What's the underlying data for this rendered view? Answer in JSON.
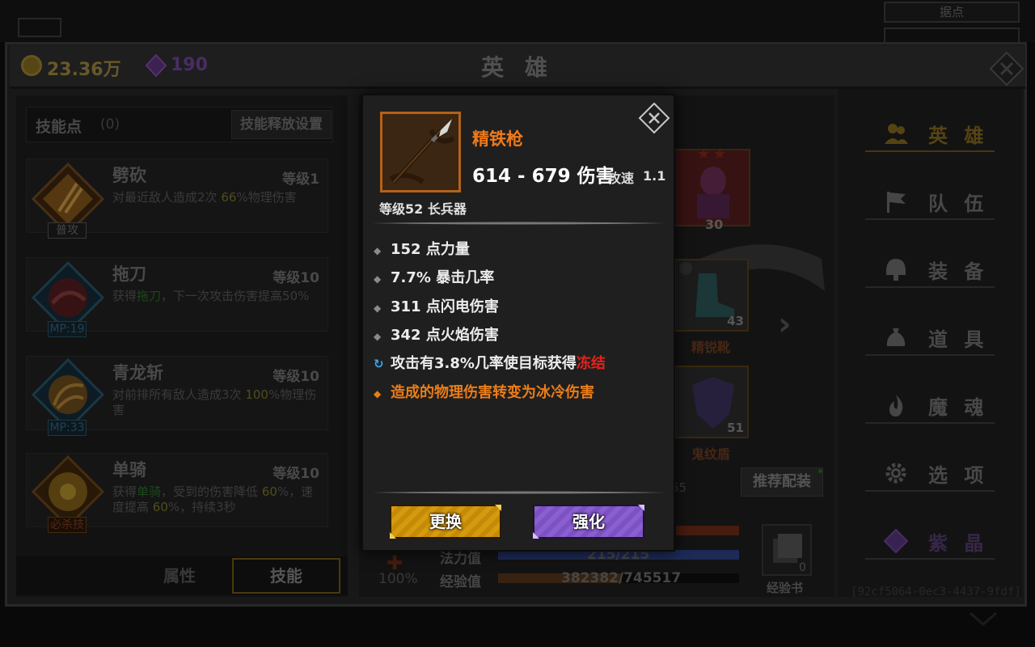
{
  "top": {
    "tag_label": "据点"
  },
  "header": {
    "gold": "23.36万",
    "gems": "190",
    "title": "英 雄"
  },
  "skills_panel": {
    "points_label": "技能点",
    "points_value": "(0)",
    "release_settings": "技能释放设置",
    "items": [
      {
        "name": "劈砍",
        "level": "等级1",
        "tag": "普攻",
        "desc_parts": [
          "对最近敌人造成2次 ",
          "66",
          "%物理伤害"
        ]
      },
      {
        "name": "拖刀",
        "level": "等级10",
        "tag": "MP:19",
        "desc_parts": [
          "获得",
          "拖刀",
          "，下一次攻击伤害提高50%"
        ]
      },
      {
        "name": "青龙斩",
        "level": "等级10",
        "tag": "MP:33",
        "desc_parts": [
          "对前排所有敌人造成3次 ",
          "100",
          "%物理伤害"
        ]
      },
      {
        "name": "单骑",
        "level": "等级10",
        "tag": "必杀技",
        "desc_parts": [
          "获得",
          "单骑",
          "，受到的伤害降低 ",
          "60",
          "%，速度提高 ",
          "60",
          "%，持续3秒"
        ]
      }
    ],
    "tabs": {
      "attributes": "属性",
      "skills": "技能"
    }
  },
  "hero_area": {
    "hero_level": "30",
    "boots": {
      "level": "43",
      "name": "精锐靴"
    },
    "shield": {
      "level": "51",
      "name": "鬼纹盾"
    },
    "recommend_button": "推荐配装",
    "partial_number": "55",
    "pct": "100%",
    "stats": [
      {
        "label": "法力值",
        "value": "215/215",
        "fill": 1.0
      },
      {
        "label": "经验值",
        "value": "382382/745517",
        "fill": 0.513
      }
    ],
    "exp_book": {
      "count": "0",
      "label": "经验书"
    }
  },
  "nav": {
    "items": [
      {
        "label": "英 雄",
        "icon": "people-icon"
      },
      {
        "label": "队 伍",
        "icon": "flag-icon"
      },
      {
        "label": "装 备",
        "icon": "helmet-icon"
      },
      {
        "label": "道 具",
        "icon": "bag-icon"
      },
      {
        "label": "魔 魂",
        "icon": "flame-icon"
      },
      {
        "label": "选 项",
        "icon": "gear-icon"
      },
      {
        "label": "紫 晶",
        "icon": "gem-icon"
      }
    ],
    "guid": "[92cf5064-0ec3-4437-9fdf]"
  },
  "popup": {
    "item_name": "精铁枪",
    "damage": "614 - 679 伤害",
    "speed_label": "攻速",
    "speed_value": "1.1",
    "subtitle": "等级52 长兵器",
    "attributes": [
      "152 点力量",
      "7.7% 暴击几率",
      "311 点闪电伤害",
      "342 点火焰伤害"
    ],
    "proc_text": "攻击有3.8%几率使目标获得",
    "proc_effect": "冻结",
    "special": "造成的物理伤害转变为冰冷伤害",
    "replace_button": "更换",
    "upgrade_button": "强化"
  },
  "colors": {
    "item_name": "#ef7a1a",
    "freeze": "#e5211b",
    "gold_button": "#d59a0d",
    "purple_button": "#8a5fd0"
  }
}
